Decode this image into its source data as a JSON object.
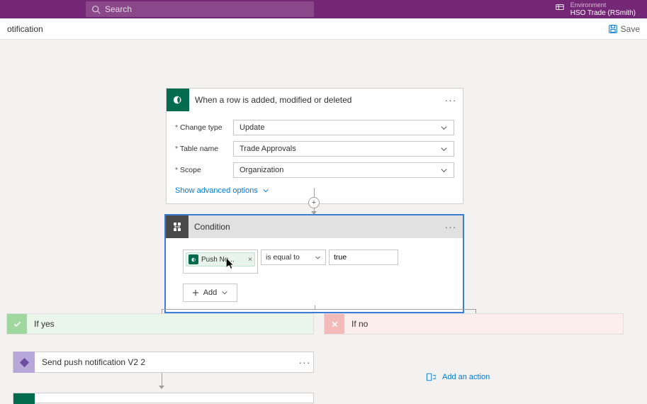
{
  "header": {
    "search_placeholder": "Search",
    "env_label": "Environment",
    "env_name": "HSO Trade (RSmith)"
  },
  "subheader": {
    "title": "otification",
    "save_label": "Save"
  },
  "trigger": {
    "title": "When a row is added, modified or deleted",
    "fields": {
      "change_type_label": "Change type",
      "change_type_value": "Update",
      "table_label": "Table name",
      "table_value": "Trade Approvals",
      "scope_label": "Scope",
      "scope_value": "Organization"
    },
    "advanced_link": "Show advanced options"
  },
  "condition": {
    "title": "Condition",
    "token_label": "Push No...",
    "operator": "is equal to",
    "value": "true",
    "add_label": "Add"
  },
  "branches": {
    "yes_label": "If yes",
    "no_label": "If no",
    "yes_action_title": "Send push notification V2 2",
    "add_action_label": "Add an action"
  }
}
